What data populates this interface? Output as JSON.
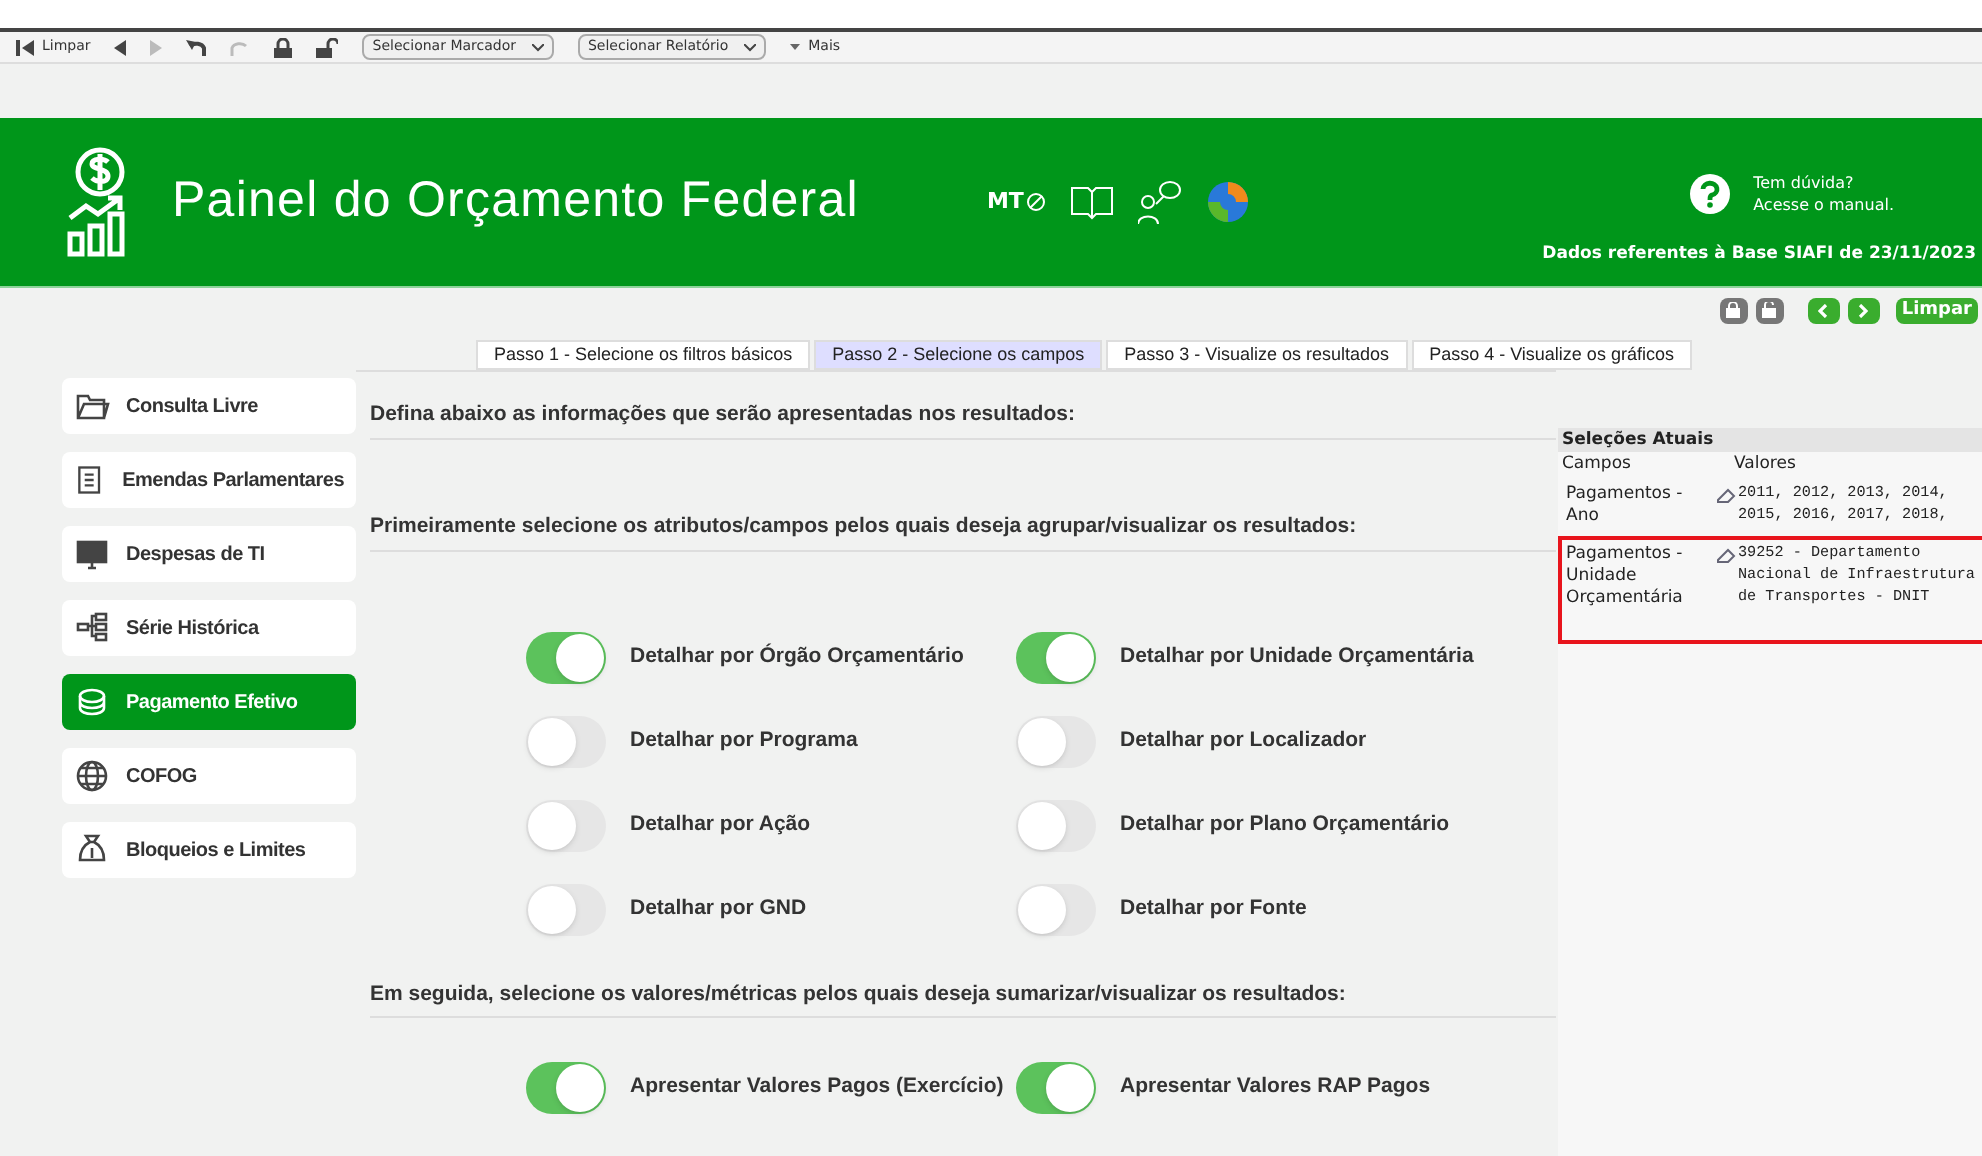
{
  "toolbar": {
    "clear": "Limpar",
    "bookmark_select": "Selecionar Marcador",
    "report_select": "Selecionar Relatório",
    "more": "Mais"
  },
  "header": {
    "title": "Painel do Orçamento Federal",
    "mt": "MT",
    "help_line1": "Tem dúvida?",
    "help_line2": "Acesse o manual.",
    "base_info": "Dados referentes à Base SIAFI de 23/11/2023"
  },
  "actions": {
    "clear": "Limpar"
  },
  "sidebar": {
    "items": [
      {
        "label": "Consulta Livre",
        "selected": false
      },
      {
        "label": "Emendas Parlamentares",
        "selected": false
      },
      {
        "label": "Despesas de TI",
        "selected": false
      },
      {
        "label": "Série Histórica",
        "selected": false
      },
      {
        "label": "Pagamento Efetivo",
        "selected": true
      },
      {
        "label": "COFOG",
        "selected": false
      },
      {
        "label": "Bloqueios e Limites",
        "selected": false
      }
    ]
  },
  "tabs": [
    {
      "label": "Passo 1 - Selecione os filtros básicos",
      "selected": false
    },
    {
      "label": "Passo 2 - Selecione os campos",
      "selected": true
    },
    {
      "label": "Passo 3 - Visualize os resultados",
      "selected": false
    },
    {
      "label": "Passo 4 - Visualize os gráficos",
      "selected": false
    }
  ],
  "intro": "Defina abaixo as informações que serão apresentadas nos resultados:",
  "attributes_heading": "Primeiramente selecione os atributos/campos pelos quais deseja agrupar/visualizar os resultados:",
  "attribute_toggles": [
    {
      "label": "Detalhar por Órgão Orçamentário",
      "on": true
    },
    {
      "label": "Detalhar por Unidade Orçamentária",
      "on": true
    },
    {
      "label": "Detalhar por Programa",
      "on": false
    },
    {
      "label": "Detalhar por Localizador",
      "on": false
    },
    {
      "label": "Detalhar por Ação",
      "on": false
    },
    {
      "label": "Detalhar por Plano Orçamentário",
      "on": false
    },
    {
      "label": "Detalhar por GND",
      "on": false
    },
    {
      "label": "Detalhar por Fonte",
      "on": false
    }
  ],
  "metrics_heading": "Em seguida, selecione os valores/métricas pelos quais deseja sumarizar/visualizar os resultados:",
  "metric_toggles": [
    {
      "label": "Apresentar Valores Pagos (Exercício)",
      "on": true
    },
    {
      "label": "Apresentar Valores RAP Pagos",
      "on": true
    }
  ],
  "current_selections": {
    "title": "Seleções Atuais",
    "columns": [
      "Campos",
      "Valores"
    ],
    "rows": [
      {
        "field": "Pagamentos - Ano",
        "values": "2011, 2012, 2013, 2014, 2015, 2016, 2017, 2018,",
        "selected": false
      },
      {
        "field": "Pagamentos - Unidade Orçamentária",
        "values": "39252 - Departamento Nacional de Infraestrutura de Transportes - DNIT",
        "selected": true
      }
    ]
  }
}
